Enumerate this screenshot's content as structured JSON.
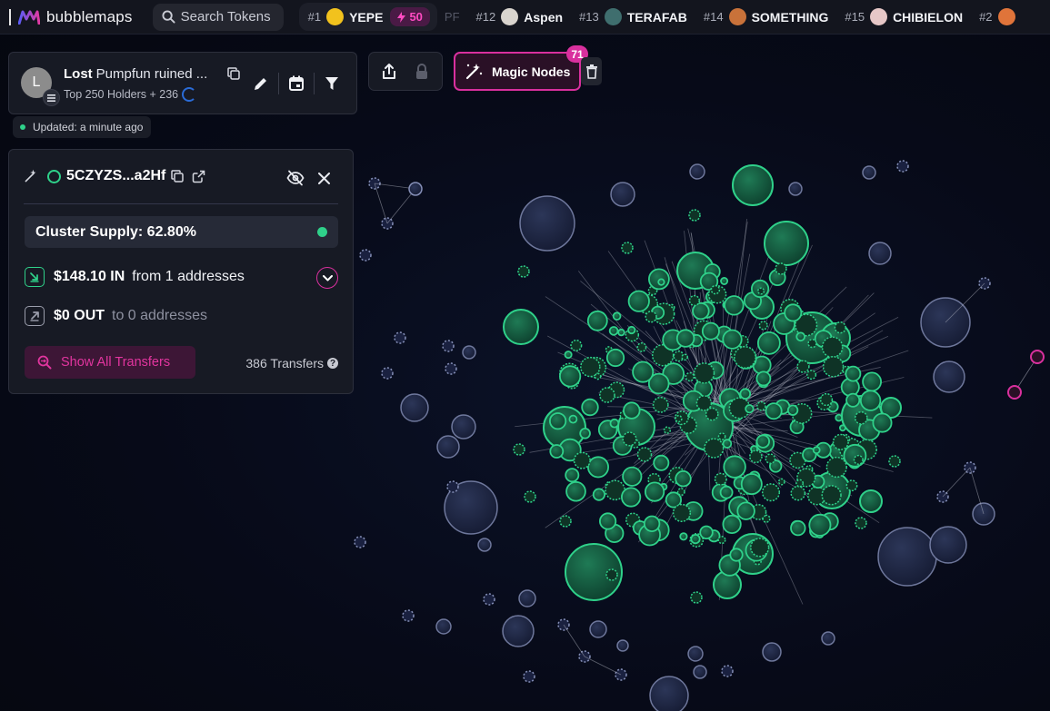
{
  "brand": {
    "name": "bubblemaps"
  },
  "search": {
    "label": "Search Tokens"
  },
  "ticker": [
    {
      "rank": "#1",
      "symbol": "YEPE",
      "boost": "50",
      "avatar_color": "#f2c21d"
    },
    {
      "rank": "#12",
      "symbol": "Aspen",
      "avatar_color": "#d9d4ce"
    },
    {
      "rank": "#13",
      "symbol": "TERAFAB",
      "avatar_color": "#3f6e6e"
    },
    {
      "rank": "#14",
      "symbol": "SOMETHING",
      "avatar_color": "#c9723a"
    },
    {
      "rank": "#15",
      "symbol": "CHIBIELON",
      "avatar_color": "#e6c7c7"
    },
    {
      "rank": "#2",
      "symbol": "",
      "avatar_color": "#e0743a"
    }
  ],
  "ticker_ghost": "PF",
  "map": {
    "title": "Lost",
    "name": "Pumpfun ruined ...",
    "avatar_letter": "L",
    "holders": "Top 250 Holders + 236",
    "updated": "Updated: a minute ago"
  },
  "magic_nodes": {
    "label": "Magic Nodes",
    "count": "71"
  },
  "wallet": {
    "address": "5CZYZS...a2Hf",
    "cluster_supply": "Cluster Supply: 62.80%",
    "in_amount": "$148.10 IN",
    "in_desc": "from 1 addresses",
    "out_amount": "$0 OUT",
    "out_desc": "to 0 addresses",
    "show_all": "Show All Transfers",
    "transfers": "386 Transfers"
  },
  "colors": {
    "accent_pink": "#d9309e",
    "cluster_green": "#2fd18a",
    "node_blue": "#2a3352",
    "background": "#070a18"
  }
}
